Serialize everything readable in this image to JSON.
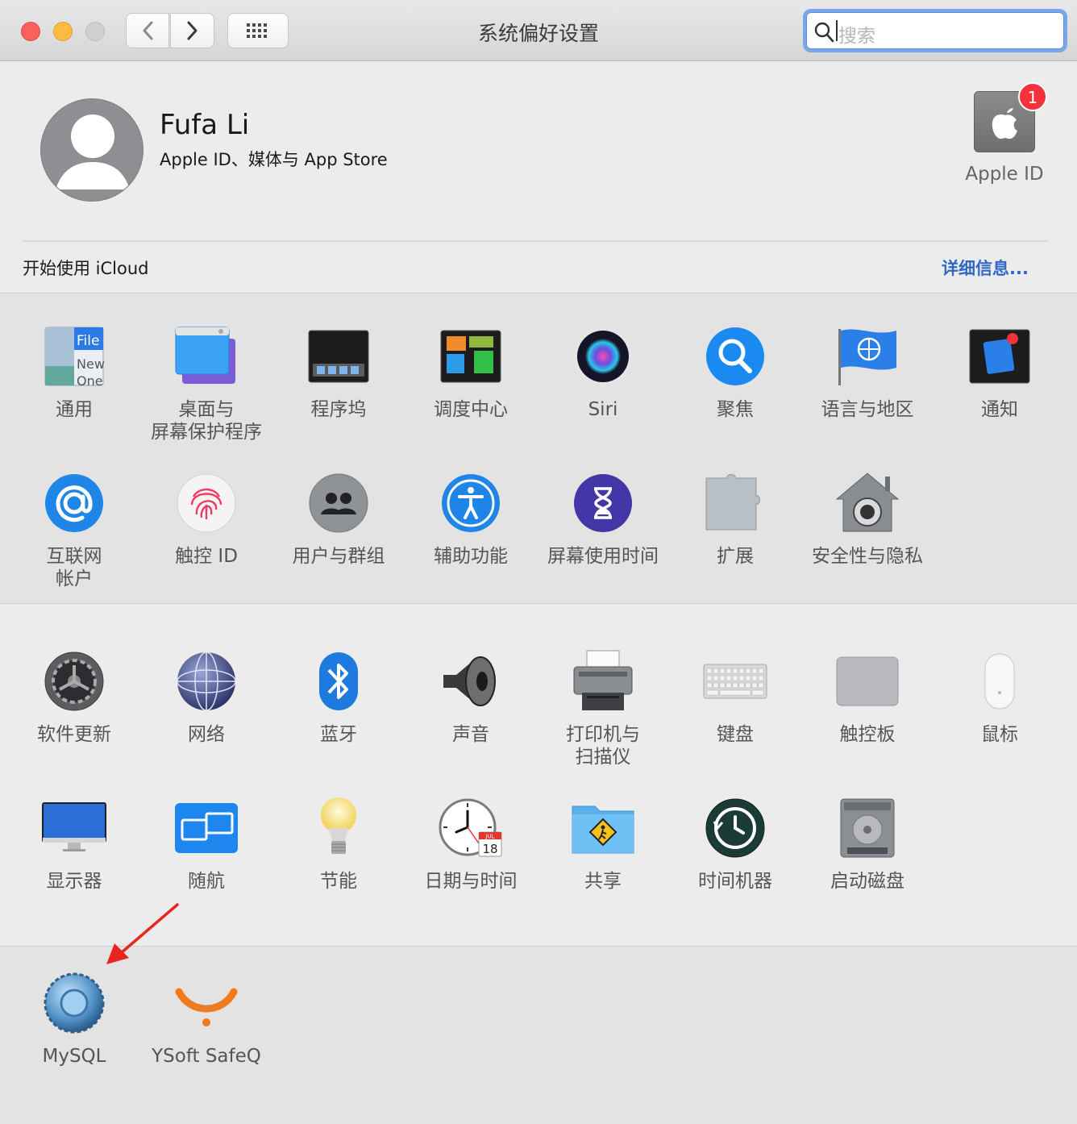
{
  "window": {
    "title": "系统偏好设置",
    "search_placeholder": "搜索"
  },
  "account": {
    "name": "Fufa Li",
    "subtitle": "Apple ID、媒体与 App Store",
    "apple_id_label": "Apple ID",
    "badge_count": "1",
    "icloud_prompt": "开始使用 iCloud",
    "details_link": "详细信息..."
  },
  "section1": [
    {
      "label": "通用",
      "icon": "general-icon"
    },
    {
      "label": "桌面与\n屏幕保护程序",
      "icon": "desktop-screensaver-icon"
    },
    {
      "label": "程序坞",
      "icon": "dock-icon"
    },
    {
      "label": "调度中心",
      "icon": "mission-control-icon"
    },
    {
      "label": "Siri",
      "icon": "siri-icon"
    },
    {
      "label": "聚焦",
      "icon": "spotlight-icon"
    },
    {
      "label": "语言与地区",
      "icon": "language-region-icon"
    },
    {
      "label": "通知",
      "icon": "notifications-icon"
    },
    {
      "label": "互联网\n帐户",
      "icon": "internet-accounts-icon"
    },
    {
      "label": "触控 ID",
      "icon": "touch-id-icon"
    },
    {
      "label": "用户与群组",
      "icon": "users-groups-icon"
    },
    {
      "label": "辅助功能",
      "icon": "accessibility-icon"
    },
    {
      "label": "屏幕使用时间",
      "icon": "screen-time-icon"
    },
    {
      "label": "扩展",
      "icon": "extensions-icon"
    },
    {
      "label": "安全性与隐私",
      "icon": "security-privacy-icon"
    }
  ],
  "section2": [
    {
      "label": "软件更新",
      "icon": "software-update-icon"
    },
    {
      "label": "网络",
      "icon": "network-icon"
    },
    {
      "label": "蓝牙",
      "icon": "bluetooth-icon"
    },
    {
      "label": "声音",
      "icon": "sound-icon"
    },
    {
      "label": "打印机与\n扫描仪",
      "icon": "printer-scanner-icon"
    },
    {
      "label": "键盘",
      "icon": "keyboard-icon"
    },
    {
      "label": "触控板",
      "icon": "trackpad-icon"
    },
    {
      "label": "鼠标",
      "icon": "mouse-icon"
    },
    {
      "label": "显示器",
      "icon": "displays-icon"
    },
    {
      "label": "随航",
      "icon": "sidecar-icon"
    },
    {
      "label": "节能",
      "icon": "energy-saver-icon"
    },
    {
      "label": "日期与时间",
      "icon": "date-time-icon"
    },
    {
      "label": "共享",
      "icon": "sharing-icon"
    },
    {
      "label": "时间机器",
      "icon": "time-machine-icon"
    },
    {
      "label": "启动磁盘",
      "icon": "startup-disk-icon"
    }
  ],
  "section3": [
    {
      "label": "MySQL",
      "icon": "mysql-icon"
    },
    {
      "label": "YSoft SafeQ",
      "icon": "ysoft-safeq-icon"
    }
  ],
  "icon_text": {
    "general": [
      "File",
      "New",
      "One"
    ],
    "calendar_month": "JUL",
    "calendar_day": "18"
  },
  "colors": {
    "accent": "#2f68c5",
    "badge": "#f3323b",
    "annotation_arrow": "#e8261f"
  }
}
